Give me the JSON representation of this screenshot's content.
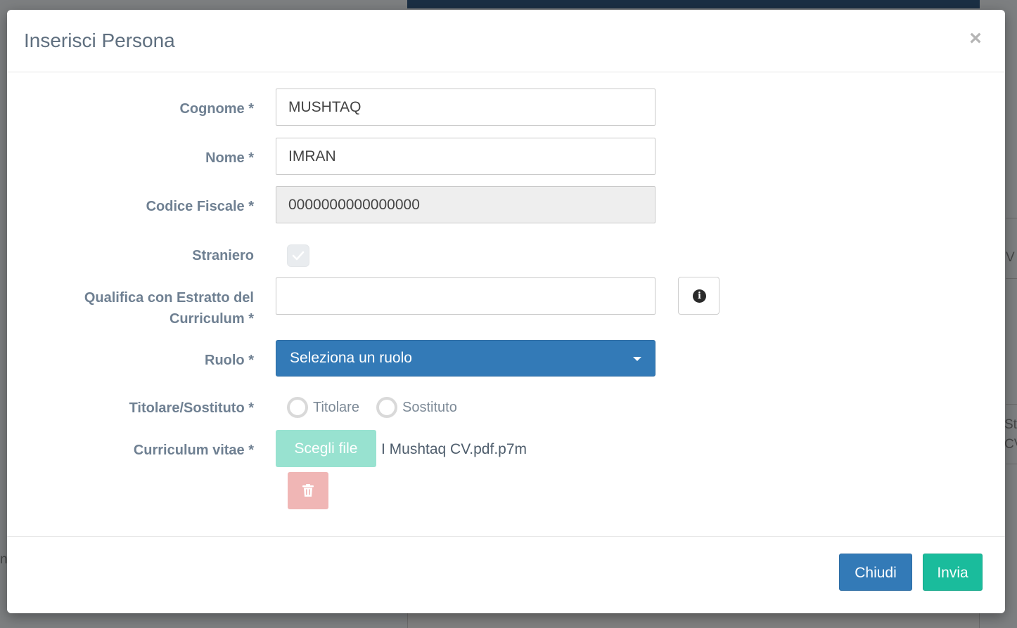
{
  "background": {
    "fragments": [
      "V",
      "Sta",
      "CV",
      "na"
    ]
  },
  "modal": {
    "title": "Inserisci Persona",
    "close_symbol": "×"
  },
  "form": {
    "cognome": {
      "label": "Cognome *",
      "value": "MUSHTAQ"
    },
    "nome": {
      "label": "Nome *",
      "value": "IMRAN"
    },
    "codice_fiscale": {
      "label": "Codice Fiscale *",
      "value": "0000000000000000",
      "disabled": true
    },
    "straniero": {
      "label": "Straniero",
      "checked": true,
      "disabled": true
    },
    "qualifica": {
      "label_line1": "Qualifica con Estratto del",
      "label_line2": "Curriculum *",
      "value": ""
    },
    "ruolo": {
      "label": "Ruolo *",
      "selected": "Seleziona un ruolo"
    },
    "titolare_sostituto": {
      "label": "Titolare/Sostituto *",
      "options": [
        "Titolare",
        "Sostituto"
      ]
    },
    "curriculum": {
      "label": "Curriculum vitae *",
      "button_label": "Scegli file",
      "file_name": "I Mushtaq CV.pdf.p7m"
    }
  },
  "footer": {
    "close_label": "Chiudi",
    "send_label": "Invia"
  },
  "icons": {
    "info": "info-circle-icon",
    "trash": "trash-icon",
    "check": "check-icon",
    "caret": "caret-down-icon"
  },
  "colors": {
    "primary": "#337ab7",
    "success": "#1abc9c",
    "file_button": "#98e2d0",
    "danger_light": "#f0b6b5",
    "label": "#6f8092",
    "title": "#5f6f7f"
  }
}
